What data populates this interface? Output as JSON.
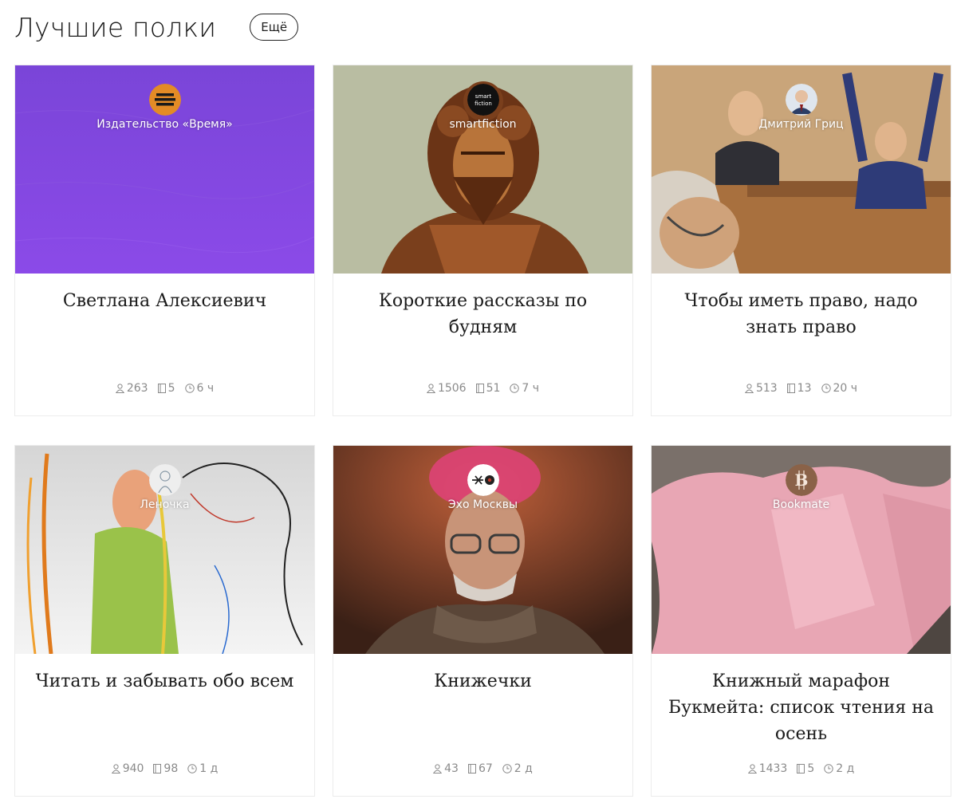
{
  "page": {
    "title": "Лучшие полки",
    "more_label": "Ещё"
  },
  "icons": {
    "readers": "person-icon",
    "books": "book-icon",
    "time": "clock-icon"
  },
  "colors": {
    "stats_text": "#8a8a8a",
    "title_text": "#1a1a1a"
  },
  "shelves": [
    {
      "owner": "Издательство «Время»",
      "title": "Светлана Алексиевич",
      "readers": "263",
      "books": "5",
      "updated": "6 ч"
    },
    {
      "owner": "smartfiction",
      "title": "Короткие рассказы по будням",
      "readers": "1506",
      "books": "51",
      "updated": "7 ч"
    },
    {
      "owner": "Дмитрий Гриц",
      "title": "Чтобы иметь право, надо знать право",
      "readers": "513",
      "books": "13",
      "updated": "20 ч"
    },
    {
      "owner": "Леночка",
      "title": "Читать и забывать обо всем",
      "readers": "940",
      "books": "98",
      "updated": "1 д"
    },
    {
      "owner": "Эхо Москвы",
      "title": "Книжечки",
      "readers": "43",
      "books": "67",
      "updated": "2 д"
    },
    {
      "owner": "Bookmate",
      "title": "Книжный марафон Букмейта: список чтения на осень",
      "readers": "1433",
      "books": "5",
      "updated": "2 д"
    }
  ]
}
